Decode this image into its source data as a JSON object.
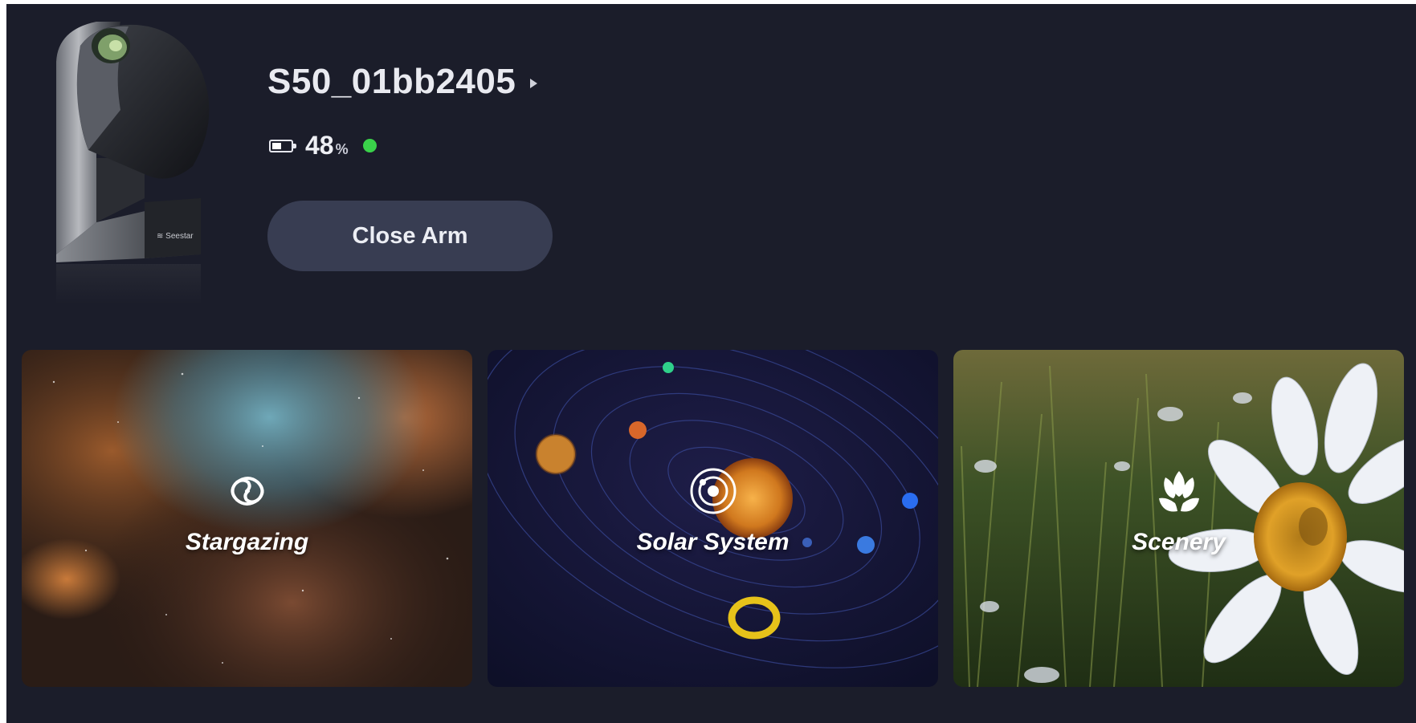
{
  "device": {
    "name": "S50_01bb2405",
    "battery_percent": "48",
    "battery_unit": "%",
    "battery_level": 0.48,
    "connection_status_color": "#3ad24a",
    "close_arm_label": "Close Arm"
  },
  "modes": [
    {
      "label": "Stargazing",
      "icon": "galaxy-icon"
    },
    {
      "label": "Solar System",
      "icon": "solar-system-icon"
    },
    {
      "label": "Scenery",
      "icon": "flower-icon"
    }
  ],
  "colors": {
    "background": "#1b1d2a",
    "button": "#383d52",
    "status_green": "#3ad24a"
  }
}
